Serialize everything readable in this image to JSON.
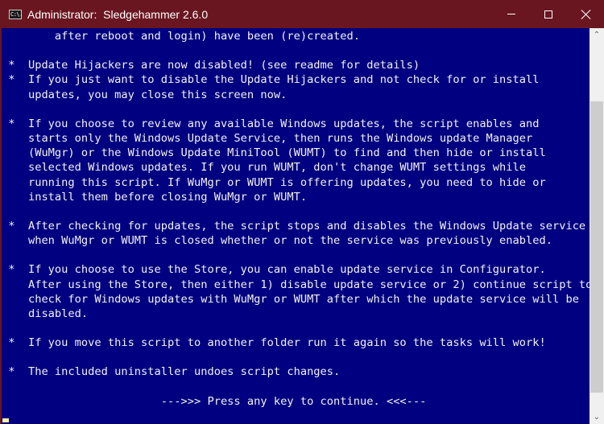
{
  "window": {
    "title": "Administrator:  Sledgehammer 2.6.0",
    "icon_label": "C:\\.",
    "icon": "cmd-console-icon",
    "controls": {
      "minimize": "minimize-icon",
      "maximize": "maximize-icon",
      "close": "close-icon"
    }
  },
  "colors": {
    "titlebar": "#6a1620",
    "console_background": "#000080",
    "console_text": "#f2f2f2",
    "cursor": "#f9f1a5",
    "scrollbar_track": "#f0f0f0",
    "scrollbar_thumb": "#cdcdcd"
  },
  "console": {
    "lines": [
      "        after reboot and login) have been (re)created.",
      "",
      " *  Update Hijackers are now disabled! (see readme for details)",
      " *  If you just want to disable the Update Hijackers and not check for or install",
      "    updates, you may close this screen now.",
      "",
      " *  If you choose to review any available Windows updates, the script enables and",
      "    starts only the Windows Update Service, then runs the Windows update Manager",
      "    (WuMgr) or the Windows Update MiniTool (WUMT) to find and then hide or install",
      "    selected Windows updates. If you run WUMT, don't change WUMT settings while",
      "    running this script. If WuMgr or WUMT is offering updates, you need to hide or",
      "    install them before closing WuMgr or WUMT.",
      "",
      " *  After checking for updates, the script stops and disables the Windows Update service",
      "    when WuMgr or WUMT is closed whether or not the service was previously enabled.",
      "",
      " *  If you choose to use the Store, you can enable update service in Configurator.",
      "    After using the Store, then either 1) disable update service or 2) continue script to",
      "    check for Windows updates with WuMgr or WUMT after which the update service will be",
      "    disabled.",
      "",
      " *  If you move this script to another folder run it again so the tasks will work!",
      "",
      " *  The included uninstaller undoes script changes.",
      "",
      "                        --->>> Press any key to continue. <<<---"
    ]
  },
  "scrollbar": {
    "up_arrow": "scroll-up-icon",
    "down_arrow": "scroll-down-icon",
    "position_fraction": 0.77,
    "visible_fraction": 0.79
  }
}
